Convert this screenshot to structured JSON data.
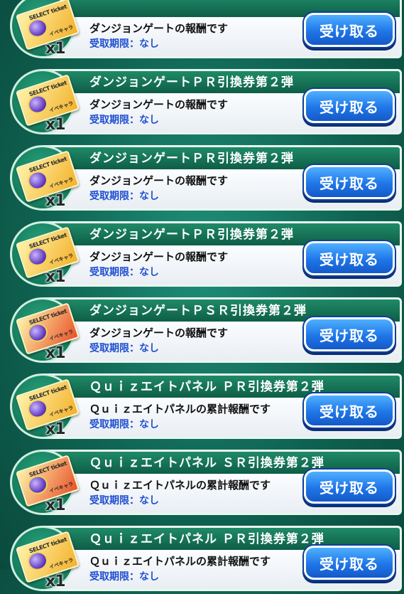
{
  "items": [
    {
      "title": "",
      "desc": "ダンジョンゲートの報酬です",
      "deadline": "受取期限：なし",
      "button": "受け取る",
      "quantity": "x1",
      "ticket_color": "#f3b12a"
    },
    {
      "title": "ダンジョンゲートＰＲ引換券第２弾",
      "desc": "ダンジョンゲートの報酬です",
      "deadline": "受取期限：なし",
      "button": "受け取る",
      "quantity": "x1",
      "ticket_color": "#f3b12a"
    },
    {
      "title": "ダンジョンゲートＰＲ引換券第２弾",
      "desc": "ダンジョンゲートの報酬です",
      "deadline": "受取期限：なし",
      "button": "受け取る",
      "quantity": "x1",
      "ticket_color": "#f3b12a"
    },
    {
      "title": "ダンジョンゲートＰＲ引換券第２弾",
      "desc": "ダンジョンゲートの報酬です",
      "deadline": "受取期限：なし",
      "button": "受け取る",
      "quantity": "x1",
      "ticket_color": "#f3b12a"
    },
    {
      "title": "ダンジョンゲートＰＳＲ引換券第２弾",
      "desc": "ダンジョンゲートの報酬です",
      "deadline": "受取期限：なし",
      "button": "受け取る",
      "quantity": "x1",
      "ticket_color": "#e8522a"
    },
    {
      "title": "Ｑｕｉｚエイトパネル ＰＲ引換券第２弾",
      "desc": "Ｑｕｉｚエイトパネルの累計報酬です",
      "deadline": "受取期限：なし",
      "button": "受け取る",
      "quantity": "x1",
      "ticket_color": "#f3b12a"
    },
    {
      "title": "Ｑｕｉｚエイトパネル ＳＲ引換券第２弾",
      "desc": "Ｑｕｉｚエイトパネルの累計報酬です",
      "deadline": "受取期限：なし",
      "button": "受け取る",
      "quantity": "x1",
      "ticket_color": "#e8522a"
    },
    {
      "title": "Ｑｕｉｚエイトパネル ＰＲ引換券第２弾",
      "desc": "Ｑｕｉｚエイトパネルの累計報酬です",
      "deadline": "受取期限：なし",
      "button": "受け取る",
      "quantity": "x1",
      "ticket_color": "#f3b12a"
    }
  ],
  "ticket_label": "SELECT ticket",
  "ticket_sublabel": "イベキャラ"
}
